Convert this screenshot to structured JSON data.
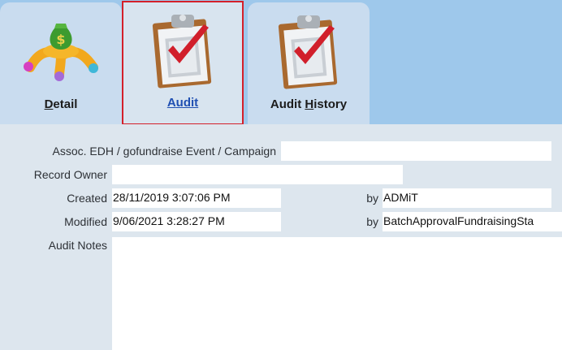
{
  "tabs": [
    {
      "label_pre": "",
      "label_mn": "D",
      "label_post": "etail",
      "icon": "money-bag-hand-icon"
    },
    {
      "label_pre": "",
      "label_mn": "A",
      "label_post": "udit",
      "icon": "clipboard-check-icon",
      "selected": true
    },
    {
      "label_pre": "Audit ",
      "label_mn": "H",
      "label_post": "istory",
      "icon": "clipboard-check-icon"
    }
  ],
  "form": {
    "assoc_label": "Assoc. EDH / gofundraise Event / Campaign",
    "assoc_value": "",
    "owner_label": "Record Owner",
    "owner_value": "",
    "created_label": "Created",
    "created_value": "28/11/2019 3:07:06 PM",
    "created_by_label": "by",
    "created_by_value": "ADMiT",
    "modified_label": "Modified",
    "modified_value": "9/06/2021 3:28:27 PM",
    "modified_by_label": "by",
    "modified_by_value": "BatchApprovalFundraisingSta",
    "notes_label": "Audit Notes",
    "notes_value": ""
  },
  "colors": {
    "tab_bar": "#9ec8eb",
    "selected_border": "#d4202a",
    "selected_label": "#1f4fb2",
    "background": "#dde6ee"
  }
}
